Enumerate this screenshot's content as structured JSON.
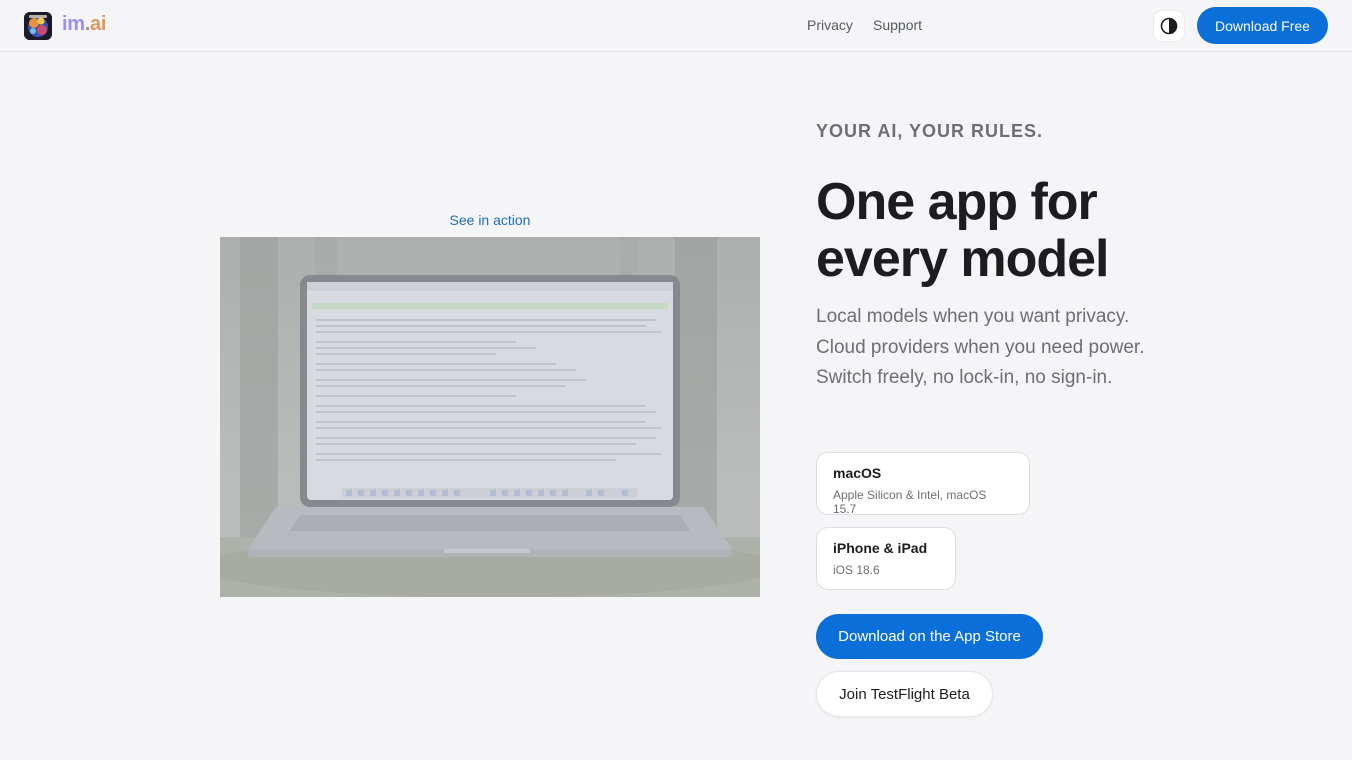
{
  "header": {
    "brand": {
      "part1": "im",
      "part2": ".",
      "part3": "ai"
    },
    "nav": [
      {
        "label": "Privacy"
      },
      {
        "label": "Support"
      }
    ],
    "theme_toggle_icon": "contrast-icon",
    "download_label": "Download Free"
  },
  "media": {
    "link_label": "See in action",
    "image_icon": "laptop-in-forest-image"
  },
  "hero": {
    "eyebrow": "YOUR AI, YOUR RULES.",
    "headline_line1": "One app for",
    "headline_line2": "every model",
    "subtitle": "Local models when you want privacy. Cloud providers when you need power. Switch freely, no lock-in, no sign-in."
  },
  "platforms": [
    {
      "title": "macOS",
      "desc": "Apple Silicon & Intel, macOS 15.7"
    },
    {
      "title": "iPhone & iPad",
      "desc": "iOS 18.6"
    }
  ],
  "actions": {
    "app_store_label": "Download on the App Store",
    "testflight_label": "Join TestFlight Beta"
  },
  "colors": {
    "accent": "#0a6fd8",
    "link": "#1b6fc2",
    "background": "#f5f5f7"
  }
}
